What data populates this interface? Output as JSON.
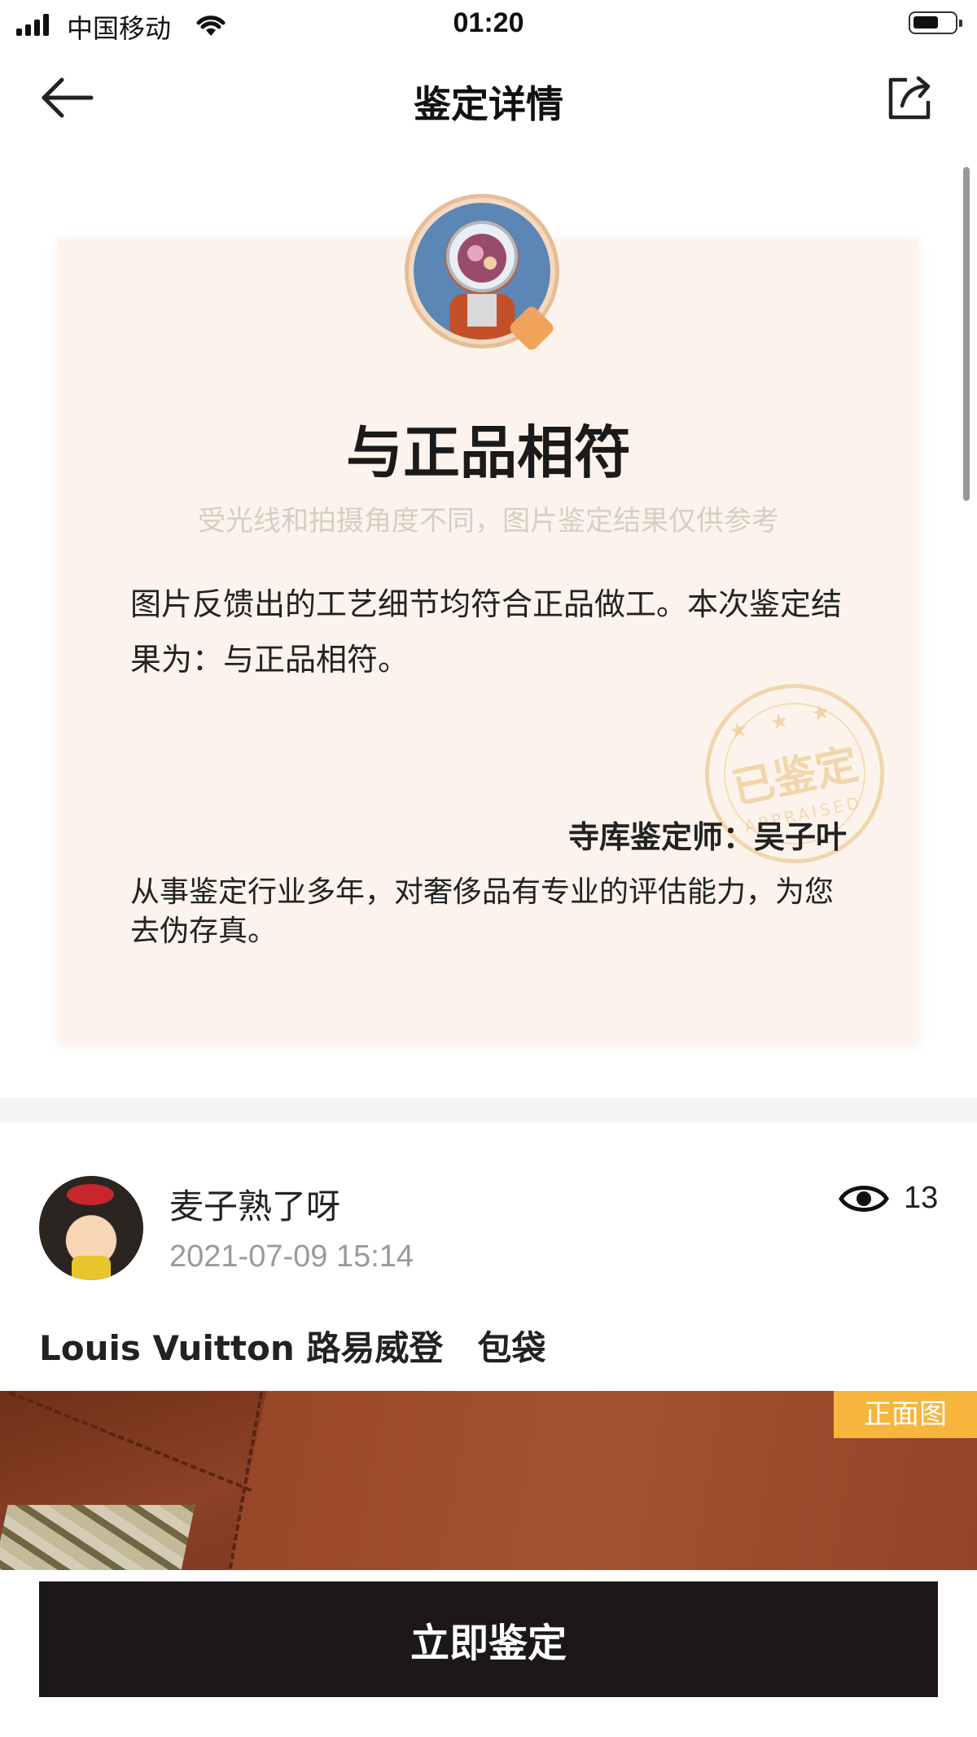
{
  "status_bar": {
    "carrier": "中国移动",
    "time": "01:20"
  },
  "nav": {
    "title": "鉴定详情",
    "back_icon": "arrow-left-icon",
    "share_icon": "share-icon"
  },
  "certificate": {
    "result": "与正品相符",
    "disclaimer": "受光线和拍摄角度不同，图片鉴定结果仅供参考",
    "description": "图片反馈出的工艺细节均符合正品做工。本次鉴定结果为：与正品相符。",
    "stamp_text": "已鉴定",
    "stamp_stars": "★ ★ ★",
    "stamp_en": "APPRAISED",
    "appraiser": "寺库鉴定师：吴子叶",
    "appraiser_desc": "从事鉴定行业多年，对奢侈品有专业的评估能力，为您去伪存真。",
    "accent_color": "#e8be78"
  },
  "post": {
    "username": "麦子熟了呀",
    "time": "2021-07-09 15:14",
    "view_count": "13",
    "item_title": "Louis Vuitton 路易威登　包袋",
    "photo_tag": "正面图"
  },
  "actions": {
    "appraise_label": "立即鉴定"
  }
}
